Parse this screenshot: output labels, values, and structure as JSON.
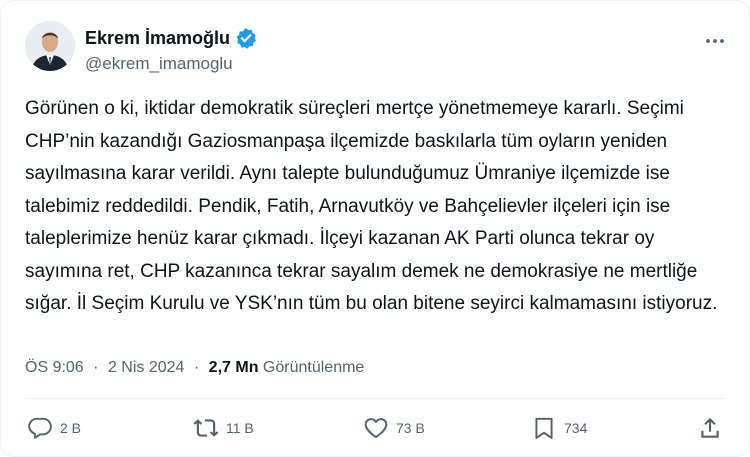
{
  "author": {
    "display_name": "Ekrem İmamoğlu",
    "handle": "@ekrem_imamoglu",
    "verified_icon": "verified-badge-icon",
    "verified_color": "#1d9bf0"
  },
  "post": {
    "text": "Görünen o ki, iktidar demokratik süreçleri mertçe yönetmemeye kararlı. Seçimi CHP’nin kazandığı Gaziosmanpaşa ilçemizde baskılarla tüm oyların yeniden sayılmasına karar verildi. Aynı talepte bulunduğumuz Ümraniye ilçemizde ise talebimiz reddedildi. Pendik, Fatih, Arnavutköy ve Bahçelievler ilçeleri için ise taleplerimize henüz karar çıkmadı. İlçeyi kazanan AK Parti olunca tekrar oy sayımına ret, CHP kazanınca tekrar sayalım demek ne demokrasiye ne mertliğe sığar. İl Seçim Kurulu ve YSK’nın tüm bu olan bitene seyirci kalmamasını istiyoruz.",
    "time": "ÖS 9:06",
    "date": "2 Nis 2024",
    "separator": "·",
    "views_count": "2,7 Mn",
    "views_label": "Görüntülenme"
  },
  "actions": {
    "reply_count": "2 B",
    "repost_count": "11 B",
    "like_count": "73 B",
    "bookmark_count": "734",
    "icons": [
      "reply-icon",
      "repost-icon",
      "like-icon",
      "bookmark-icon",
      "share-icon"
    ]
  },
  "colors": {
    "text_primary": "#0f1419",
    "text_secondary": "#536471",
    "divider": "#eff3f4",
    "accent": "#1d9bf0"
  }
}
